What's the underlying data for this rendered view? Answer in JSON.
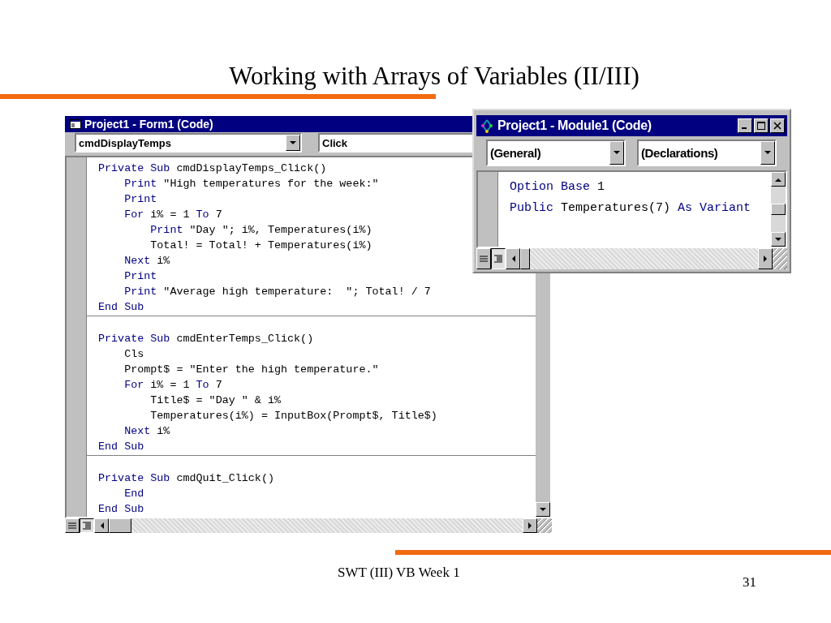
{
  "slide": {
    "title": "Working with Arrays of Variables (II/III)",
    "footer": "SWT (III) VB Week 1",
    "page_number": "31"
  },
  "form_window": {
    "title": "Project1 - Form1 (Code)",
    "object_combo": "cmdDisplayTemps",
    "procedure_combo": "Click",
    "procedures": [
      {
        "lines": [
          [
            {
              "kind": "keyword",
              "text": "Private Sub"
            },
            {
              "kind": "plain",
              "text": " cmdDisplayTemps_Click()"
            }
          ],
          [
            {
              "kind": "keyword",
              "text": "    Print"
            },
            {
              "kind": "plain",
              "text": " \"High temperatures for the week:\""
            }
          ],
          [
            {
              "kind": "keyword",
              "text": "    Print"
            }
          ],
          [
            {
              "kind": "keyword",
              "text": "    For"
            },
            {
              "kind": "plain",
              "text": " i% = 1 "
            },
            {
              "kind": "keyword",
              "text": "To"
            },
            {
              "kind": "plain",
              "text": " 7"
            }
          ],
          [
            {
              "kind": "keyword",
              "text": "        Print"
            },
            {
              "kind": "plain",
              "text": " \"Day \"; i%, Temperatures(i%)"
            }
          ],
          [
            {
              "kind": "plain",
              "text": "        Total! = Total! + Temperatures(i%)"
            }
          ],
          [
            {
              "kind": "keyword",
              "text": "    Next"
            },
            {
              "kind": "plain",
              "text": " i%"
            }
          ],
          [
            {
              "kind": "keyword",
              "text": "    Print"
            }
          ],
          [
            {
              "kind": "keyword",
              "text": "    Print"
            },
            {
              "kind": "plain",
              "text": " \"Average high temperature:  \"; Total! / 7"
            }
          ],
          [
            {
              "kind": "keyword",
              "text": "End Sub"
            }
          ]
        ]
      },
      {
        "lines": [
          [
            {
              "kind": "keyword",
              "text": "Private Sub"
            },
            {
              "kind": "plain",
              "text": " cmdEnterTemps_Click()"
            }
          ],
          [
            {
              "kind": "plain",
              "text": "    Cls"
            }
          ],
          [
            {
              "kind": "plain",
              "text": "    Prompt$ = \"Enter the high temperature.\""
            }
          ],
          [
            {
              "kind": "keyword",
              "text": "    For"
            },
            {
              "kind": "plain",
              "text": " i% = 1 "
            },
            {
              "kind": "keyword",
              "text": "To"
            },
            {
              "kind": "plain",
              "text": " 7"
            }
          ],
          [
            {
              "kind": "plain",
              "text": "        Title$ = \"Day \" & i%"
            }
          ],
          [
            {
              "kind": "plain",
              "text": "        Temperatures(i%) = InputBox(Prompt$, Title$)"
            }
          ],
          [
            {
              "kind": "keyword",
              "text": "    Next"
            },
            {
              "kind": "plain",
              "text": " i%"
            }
          ],
          [
            {
              "kind": "keyword",
              "text": "End Sub"
            }
          ]
        ]
      },
      {
        "lines": [
          [
            {
              "kind": "keyword",
              "text": "Private Sub"
            },
            {
              "kind": "plain",
              "text": " cmdQuit_Click()"
            }
          ],
          [
            {
              "kind": "keyword",
              "text": "    End"
            }
          ],
          [
            {
              "kind": "keyword",
              "text": "End Sub"
            }
          ]
        ]
      }
    ]
  },
  "module_window": {
    "title": "Project1 - Module1 (Code)",
    "object_combo": "(General)",
    "procedure_combo": "(Declarations)",
    "procedures": [
      {
        "lines": [
          [
            {
              "kind": "keyword",
              "text": "Option Base"
            },
            {
              "kind": "plain",
              "text": " 1"
            }
          ],
          [
            {
              "kind": "keyword",
              "text": "Public"
            },
            {
              "kind": "plain",
              "text": " Temperatures(7) "
            },
            {
              "kind": "keyword",
              "text": "As Variant"
            }
          ]
        ]
      }
    ]
  }
}
